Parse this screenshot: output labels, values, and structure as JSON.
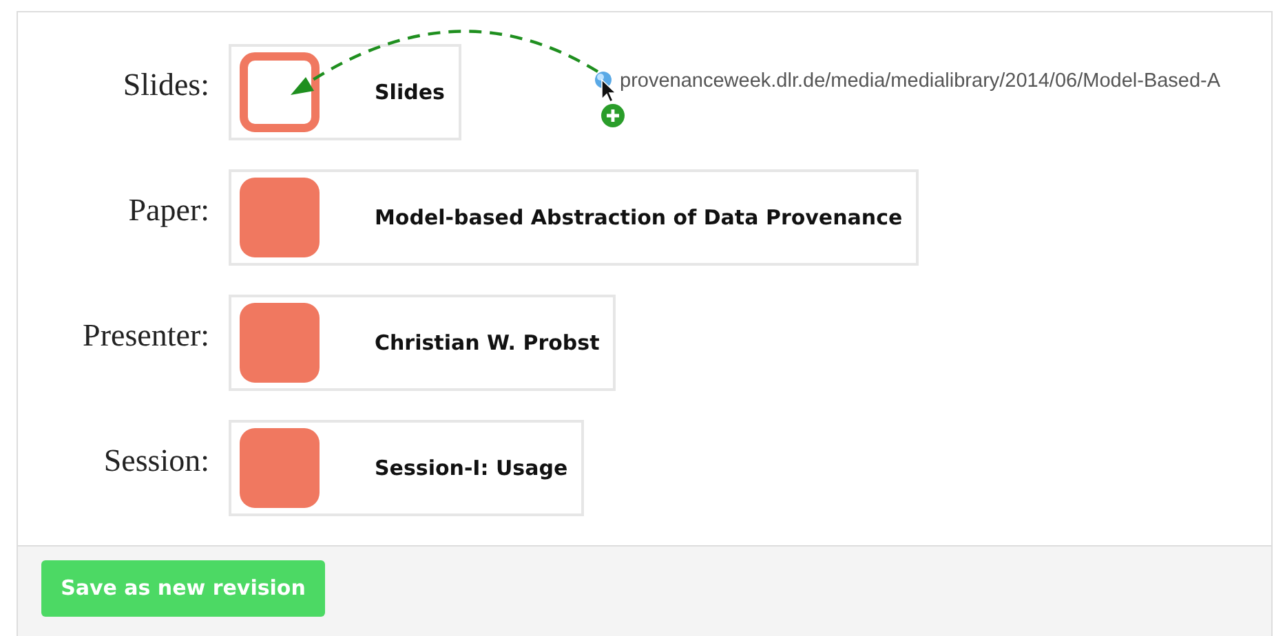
{
  "fields": [
    {
      "label": "Slides:",
      "value": "Slides",
      "filled": false
    },
    {
      "label": "Paper:",
      "value": "Model-based Abstraction of Data Provenance",
      "filled": true
    },
    {
      "label": "Presenter:",
      "value": "Christian W. Probst",
      "filled": true
    },
    {
      "label": "Session:",
      "value": "Session-I: Usage",
      "filled": true
    }
  ],
  "drag": {
    "url": "provenanceweek.dlr.de/media/medialibrary/2014/06/Model-Based-A"
  },
  "buttons": [
    "Save as new revision"
  ]
}
